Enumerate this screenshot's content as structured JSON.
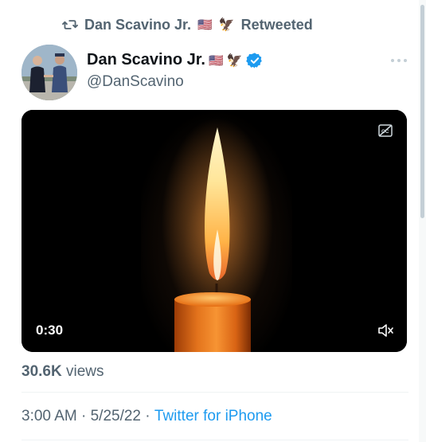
{
  "retweet": {
    "icon": "retweet-icon",
    "name": "Dan Scavino Jr.",
    "flag": "🇺🇸",
    "emoji": "🦅",
    "label": "Retweeted"
  },
  "author": {
    "name": "Dan Scavino Jr.",
    "flag": "🇺🇸",
    "emoji": "🦅",
    "handle": "@DanScavino",
    "verified_color": "#1d9bf0"
  },
  "media": {
    "duration": "0:30"
  },
  "stats": {
    "views_count": "30.6K",
    "views_label": "views"
  },
  "meta": {
    "time": "3:00 AM",
    "separator": " · ",
    "date": "5/25/22",
    "source": "Twitter for iPhone"
  },
  "colors": {
    "accent": "#1d9bf0",
    "secondary_text": "#536471"
  }
}
